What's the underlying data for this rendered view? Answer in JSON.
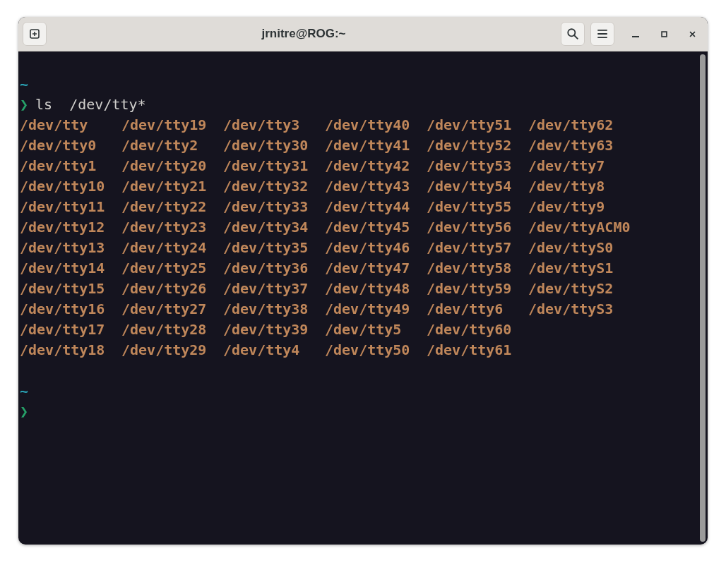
{
  "window": {
    "title": "jrnitre@ROG:~"
  },
  "session": [
    {
      "cwd": "~",
      "symbol": "❯",
      "command": "ls  /dev/tty*",
      "output": [
        [
          "/dev/tty",
          "/dev/tty19",
          "/dev/tty3",
          "/dev/tty40",
          "/dev/tty51",
          "/dev/tty62"
        ],
        [
          "/dev/tty0",
          "/dev/tty2",
          "/dev/tty30",
          "/dev/tty41",
          "/dev/tty52",
          "/dev/tty63"
        ],
        [
          "/dev/tty1",
          "/dev/tty20",
          "/dev/tty31",
          "/dev/tty42",
          "/dev/tty53",
          "/dev/tty7"
        ],
        [
          "/dev/tty10",
          "/dev/tty21",
          "/dev/tty32",
          "/dev/tty43",
          "/dev/tty54",
          "/dev/tty8"
        ],
        [
          "/dev/tty11",
          "/dev/tty22",
          "/dev/tty33",
          "/dev/tty44",
          "/dev/tty55",
          "/dev/tty9"
        ],
        [
          "/dev/tty12",
          "/dev/tty23",
          "/dev/tty34",
          "/dev/tty45",
          "/dev/tty56",
          "/dev/ttyACM0"
        ],
        [
          "/dev/tty13",
          "/dev/tty24",
          "/dev/tty35",
          "/dev/tty46",
          "/dev/tty57",
          "/dev/ttyS0"
        ],
        [
          "/dev/tty14",
          "/dev/tty25",
          "/dev/tty36",
          "/dev/tty47",
          "/dev/tty58",
          "/dev/ttyS1"
        ],
        [
          "/dev/tty15",
          "/dev/tty26",
          "/dev/tty37",
          "/dev/tty48",
          "/dev/tty59",
          "/dev/ttyS2"
        ],
        [
          "/dev/tty16",
          "/dev/tty27",
          "/dev/tty38",
          "/dev/tty49",
          "/dev/tty6",
          "/dev/ttyS3"
        ],
        [
          "/dev/tty17",
          "/dev/tty28",
          "/dev/tty39",
          "/dev/tty5",
          "/dev/tty60"
        ],
        [
          "/dev/tty18",
          "/dev/tty29",
          "/dev/tty4",
          "/dev/tty50",
          "/dev/tty61"
        ]
      ]
    },
    {
      "cwd": "~",
      "symbol": "❯"
    }
  ]
}
